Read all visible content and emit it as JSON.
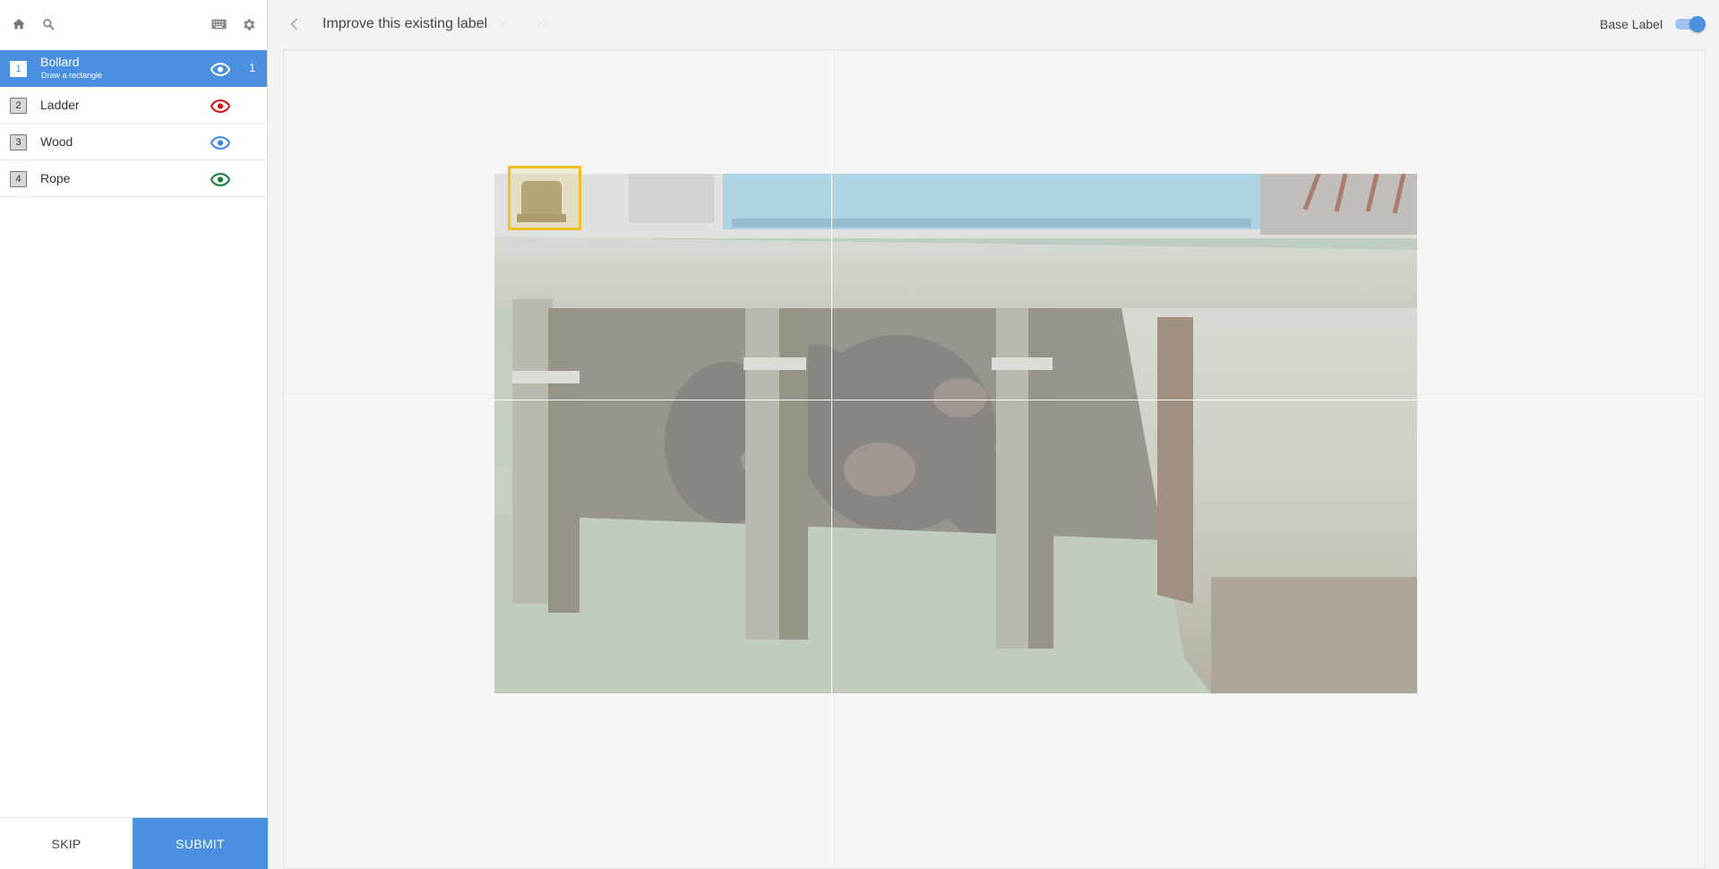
{
  "sidebar": {
    "classes": [
      {
        "key": "1",
        "name": "Bollard",
        "subtitle": "Draw a rectangle",
        "count": "1",
        "eye_color": "#ffffff"
      },
      {
        "key": "2",
        "name": "Ladder",
        "eye_color": "#d0121a"
      },
      {
        "key": "3",
        "name": "Wood",
        "eye_color": "#3a86e0"
      },
      {
        "key": "4",
        "name": "Rope",
        "eye_color": "#127a3a"
      }
    ],
    "skip_label": "SKIP",
    "submit_label": "SUBMIT"
  },
  "header": {
    "title": "Improve this existing label",
    "next_glyph": ">",
    "last_glyph": ">>",
    "base_label": "Base Label",
    "base_label_on": true
  },
  "icons": {
    "home": "home-icon",
    "search": "search-icon",
    "keyboard": "keyboard-icon",
    "settings": "gear-icon",
    "back": "chevron-left-icon",
    "visibility": "eye-icon"
  },
  "colors": {
    "accent": "#4a8fe0",
    "annotation_box": "#f0c020"
  }
}
